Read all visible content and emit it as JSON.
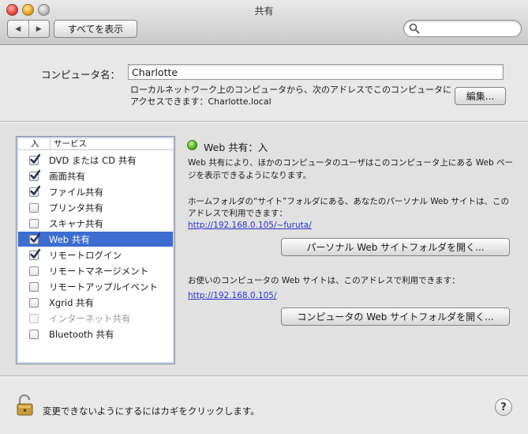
{
  "window": {
    "title": "共有"
  },
  "toolbar": {
    "back_glyph": "◀",
    "forward_glyph": "▶",
    "show_all_label": "すべてを表示",
    "search_placeholder": ""
  },
  "computer_name": {
    "label": "コンピュータ名：",
    "value": "Charlotte",
    "description": "ローカルネットワーク上のコンピュータから、次のアドレスでこのコンピュータにアクセスできます：Charlotte.local",
    "edit_label": "編集..."
  },
  "services": {
    "header_on": "入",
    "header_service": "サービス",
    "items": [
      {
        "label": "DVD または CD 共有",
        "checked": true,
        "enabled": true,
        "selected": false
      },
      {
        "label": "画面共有",
        "checked": true,
        "enabled": true,
        "selected": false
      },
      {
        "label": "ファイル共有",
        "checked": true,
        "enabled": true,
        "selected": false
      },
      {
        "label": "プリンタ共有",
        "checked": false,
        "enabled": true,
        "selected": false
      },
      {
        "label": "スキャナ共有",
        "checked": false,
        "enabled": true,
        "selected": false
      },
      {
        "label": "Web 共有",
        "checked": true,
        "enabled": true,
        "selected": true
      },
      {
        "label": "リモートログイン",
        "checked": true,
        "enabled": true,
        "selected": false
      },
      {
        "label": "リモートマネージメント",
        "checked": false,
        "enabled": true,
        "selected": false
      },
      {
        "label": "リモートアップルイベント",
        "checked": false,
        "enabled": true,
        "selected": false
      },
      {
        "label": "Xgrid 共有",
        "checked": false,
        "enabled": true,
        "selected": false
      },
      {
        "label": "インターネット共有",
        "checked": false,
        "enabled": false,
        "selected": false
      },
      {
        "label": "Bluetooth 共有",
        "checked": false,
        "enabled": true,
        "selected": false
      }
    ]
  },
  "detail": {
    "status": "Web 共有：入",
    "status_color": "#4fae1c",
    "description": "Web 共有により、ほかのコンピュータのユーザはこのコンピュータ上にある Web ページを表示できるようになります。",
    "personal_text": "ホームフォルダの“サイト”フォルダにある、あなたのパーソナル Web サイトは、このアドレスで利用できます：",
    "personal_url": "http://192.168.0.105/~furuta/",
    "personal_button": "パーソナル Web サイトフォルダを開く...",
    "computer_text": "お使いのコンピュータの Web サイトは、このアドレスで利用できます：",
    "computer_url": "http://192.168.0.105/",
    "computer_button": "コンピュータの Web サイトフォルダを開く..."
  },
  "footer": {
    "lock_text": "変更できないようにするにはカギをクリックします。",
    "help_label": "?"
  },
  "colors": {
    "selection": "#3d6ecf",
    "link": "#2a35c9"
  }
}
